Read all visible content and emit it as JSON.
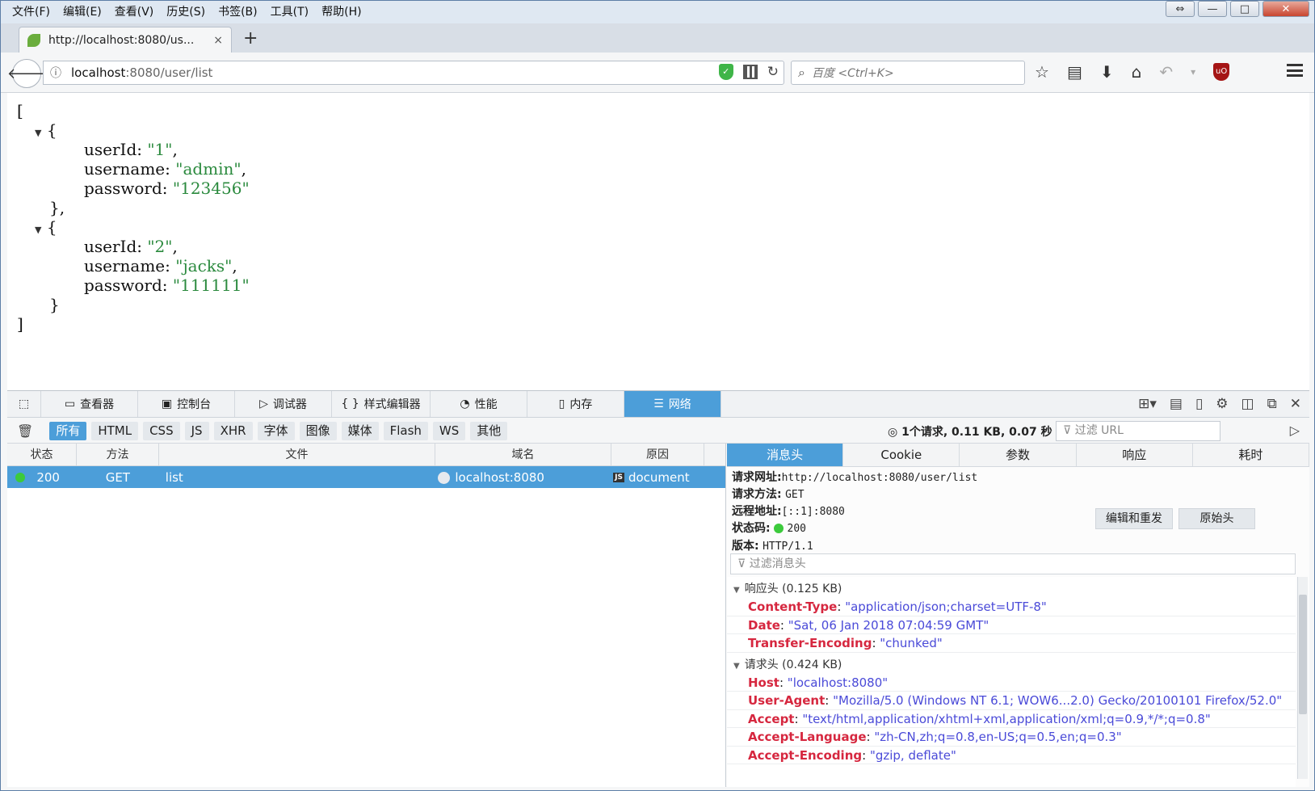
{
  "menu": [
    "文件(F)",
    "编辑(E)",
    "查看(V)",
    "历史(S)",
    "书签(B)",
    "工具(T)",
    "帮助(H)"
  ],
  "window_buttons": {
    "restore": "⇔",
    "minimize": "—",
    "maximize": "□",
    "close": "✕"
  },
  "tab": {
    "title": "http://localhost:8080/us...",
    "close": "×"
  },
  "new_tab": "+",
  "url": {
    "host": "localhost",
    "path": ":8080/user/list"
  },
  "search_placeholder": "百度 <Ctrl+K>",
  "json_view": {
    "open_bracket": "[",
    "close_bracket": "]",
    "objects": [
      {
        "open": "{",
        "close": "},",
        "userId": "\"1\"",
        "username": "\"admin\"",
        "password": "\"123456\""
      },
      {
        "open": "{",
        "close": "}",
        "userId": "\"2\"",
        "username": "\"jacks\"",
        "password": "\"111111\""
      }
    ],
    "keys": {
      "userId": "userId",
      "username": "username",
      "password": "password"
    }
  },
  "devtools": {
    "tabs": [
      {
        "label": "查看器",
        "icon": "inspector-icon"
      },
      {
        "label": "控制台",
        "icon": "console-icon"
      },
      {
        "label": "调试器",
        "icon": "debugger-icon"
      },
      {
        "label": "样式编辑器",
        "icon": "style-editor-icon"
      },
      {
        "label": "性能",
        "icon": "performance-icon"
      },
      {
        "label": "内存",
        "icon": "memory-icon"
      },
      {
        "label": "网络",
        "icon": "network-icon"
      }
    ],
    "filters": [
      "所有",
      "HTML",
      "CSS",
      "JS",
      "XHR",
      "字体",
      "图像",
      "媒体",
      "Flash",
      "WS",
      "其他"
    ],
    "summary": "1个请求, 0.11 KB, 0.07 秒",
    "url_filter_placeholder": "过滤 URL",
    "columns": [
      "状态",
      "方法",
      "文件",
      "域名",
      "原因"
    ],
    "request": {
      "status": "200",
      "method": "GET",
      "file": "list",
      "domain": "localhost:8080",
      "cause": "document"
    },
    "side_tabs": [
      "消息头",
      "Cookie",
      "参数",
      "响应",
      "耗时"
    ],
    "summary_fields": {
      "url_label": "请求网址:",
      "url": "http://localhost:8080/user/list",
      "method_label": "请求方法:",
      "method": "GET",
      "remote_label": "远程地址:",
      "remote": "[::1]:8080",
      "status_label": "状态码:",
      "status": "200",
      "version_label": "版本:",
      "version": "HTTP/1.1"
    },
    "buttons": {
      "edit_resend": "编辑和重发",
      "raw_headers": "原始头"
    },
    "header_filter_placeholder": "过滤消息头",
    "response_section": "响应头 (0.125 KB)",
    "response_headers": [
      {
        "name": "Content-Type",
        "value": "\"application/json;charset=UTF-8\""
      },
      {
        "name": "Date",
        "value": "\"Sat, 06 Jan 2018 07:04:59 GMT\""
      },
      {
        "name": "Transfer-Encoding",
        "value": "\"chunked\""
      }
    ],
    "request_section": "请求头 (0.424 KB)",
    "request_headers": [
      {
        "name": "Host",
        "value": "\"localhost:8080\""
      },
      {
        "name": "User-Agent",
        "value": "\"Mozilla/5.0 (Windows NT 6.1; WOW6...2.0) Gecko/20100101 Firefox/52.0\""
      },
      {
        "name": "Accept",
        "value": "\"text/html,application/xhtml+xml,application/xml;q=0.9,*/*;q=0.8\""
      },
      {
        "name": "Accept-Language",
        "value": "\"zh-CN,zh;q=0.8,en-US;q=0.5,en;q=0.3\""
      },
      {
        "name": "Accept-Encoding",
        "value": "\"gzip, deflate\""
      }
    ]
  },
  "colors": {
    "accent": "#4c9ed9",
    "status_ok": "#3cca3c",
    "header_name": "#d6273f",
    "header_value": "#4a4ad8",
    "json_string": "#2b8a3e"
  }
}
